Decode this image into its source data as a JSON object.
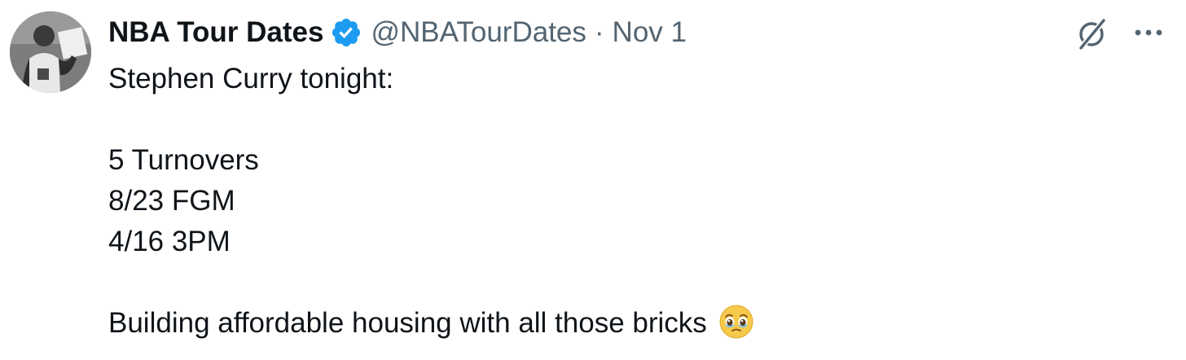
{
  "author": {
    "display_name": "NBA Tour Dates",
    "handle": "@NBATourDates",
    "separator": "·",
    "date": "Nov 1",
    "verified": true,
    "verified_color": "#1d9bf0"
  },
  "icons": {
    "verified": "verified-badge-icon",
    "grok": "grok-icon",
    "more": "more-options-icon",
    "emoji": "face-holding-back-tears-emoji"
  },
  "tweet": {
    "line1": "Stephen Curry tonight:",
    "stats": [
      "5 Turnovers",
      "8/23 FGM",
      "4/16 3PM"
    ],
    "closing": "Building affordable housing with all those bricks"
  },
  "colors": {
    "text": "#0f1419",
    "secondary": "#536471",
    "accent": "#1d9bf0"
  }
}
